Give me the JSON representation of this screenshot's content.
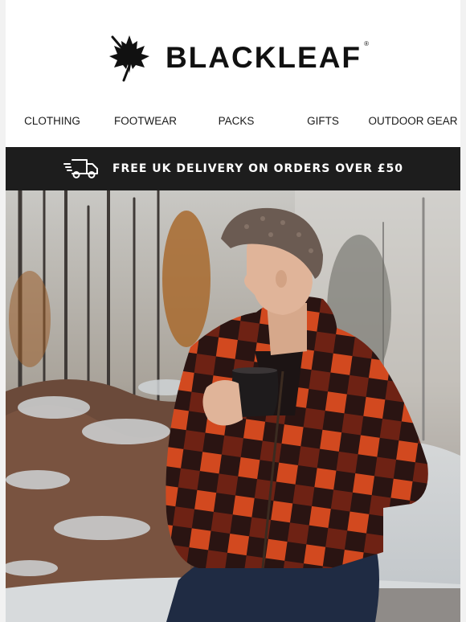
{
  "brand": {
    "name": "BLACKLEAF",
    "registered_mark": "®",
    "logo_icon": "maple-leaf-icon"
  },
  "nav": {
    "items": [
      {
        "label": "CLOTHING"
      },
      {
        "label": "FOOTWEAR"
      },
      {
        "label": "PACKS"
      },
      {
        "label": "GIFTS"
      },
      {
        "label": "OUTDOOR GEAR"
      }
    ]
  },
  "banner": {
    "icon": "delivery-truck-icon",
    "text": "FREE UK DELIVERY ON ORDERS OVER £50"
  },
  "hero": {
    "image": "woman-in-red-check-fleece-holding-mug-in-frosty-forest"
  },
  "colors": {
    "banner_bg": "#1d1d1d",
    "text": "#111111",
    "fleece_red": "#c23a1a",
    "background": "#ffffff"
  }
}
